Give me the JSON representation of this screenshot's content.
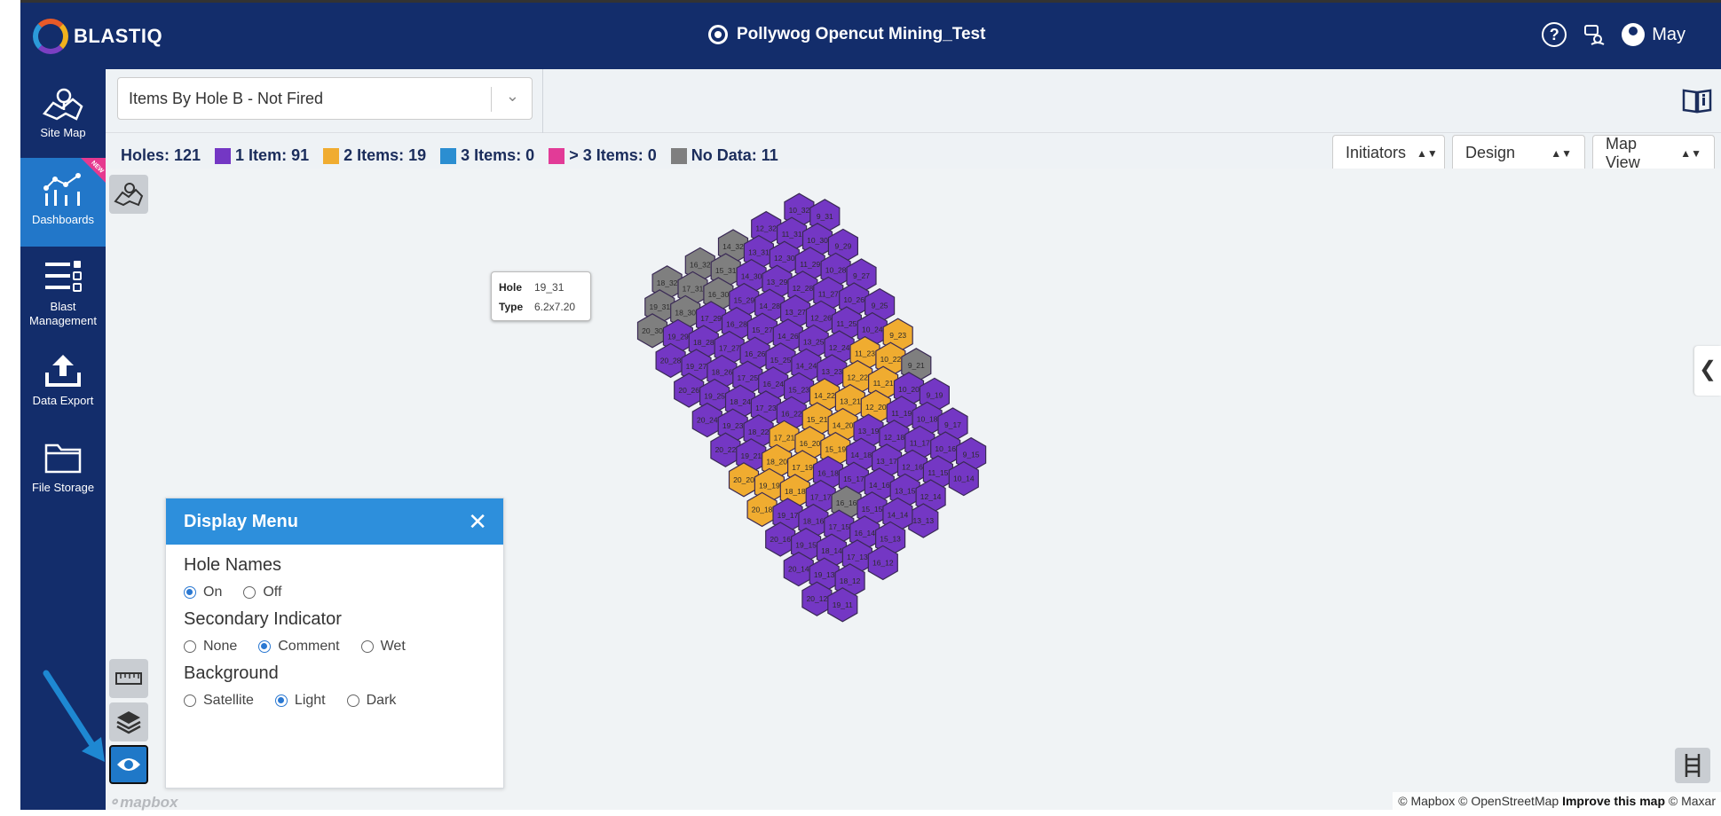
{
  "header": {
    "logo_text": "BLASTIQ",
    "project_title": "Pollywog Opencut Mining_Test",
    "user_name": "May"
  },
  "sidebar": {
    "items": [
      {
        "label": "Site Map",
        "icon": "site-map-icon"
      },
      {
        "label": "Dashboards",
        "icon": "dashboard-icon",
        "active": true,
        "badge": "NEW"
      },
      {
        "label": "Blast Management",
        "icon": "blast-management-icon"
      },
      {
        "label": "Data Export",
        "icon": "upload-icon"
      },
      {
        "label": "File Storage",
        "icon": "folder-icon"
      }
    ]
  },
  "toolbar": {
    "selected_view": "Items By Hole B - Not Fired"
  },
  "legend": {
    "holes": "Holes: 121",
    "items": [
      {
        "label": "1 Item: 91",
        "color": "#7437c4"
      },
      {
        "label": "2 Items: 19",
        "color": "#f0ac30"
      },
      {
        "label": "3 Items: 0",
        "color": "#2b8ed1"
      },
      {
        "label": "> 3 Items: 0",
        "color": "#e23b97"
      },
      {
        "label": "No Data: 11",
        "color": "#7f7f7f"
      }
    ]
  },
  "dropdowns": {
    "initiators": "Initiators",
    "design": "Design",
    "map_view": "Map View"
  },
  "tooltip": {
    "hole_label": "Hole",
    "hole_value": "19_31",
    "type_label": "Type",
    "type_value": "6.2x7.20"
  },
  "display_menu": {
    "title": "Display Menu",
    "hole_names": {
      "label": "Hole Names",
      "options": [
        "On",
        "Off"
      ],
      "selected": "On"
    },
    "secondary": {
      "label": "Secondary Indicator",
      "options": [
        "None",
        "Comment",
        "Wet"
      ],
      "selected": "Comment"
    },
    "background": {
      "label": "Background",
      "options": [
        "Satellite",
        "Light",
        "Dark"
      ],
      "selected": "Light"
    }
  },
  "attribution": {
    "mapbox": "© Mapbox",
    "osm": "© OpenStreetMap",
    "improve": "Improve this map",
    "maxar": "© Maxar"
  },
  "mapbox_logo": "mapbox",
  "pattern": {
    "colors": {
      "purple": "#7437c4",
      "yellow": "#f0ac30",
      "gray": "#7f7f7f"
    },
    "holes_top_right_to_left_rows": [
      [
        [
          "10_32",
          "P"
        ],
        [
          "9_31",
          "P"
        ]
      ],
      [
        [
          "12_32",
          "P"
        ],
        [
          "11_31",
          "P"
        ],
        [
          "10_30",
          "P"
        ],
        [
          "9_29",
          "P"
        ]
      ],
      [
        [
          "14_32",
          "G"
        ],
        [
          "13_31",
          "P"
        ],
        [
          "12_30",
          "P"
        ],
        [
          "11_29",
          "P"
        ],
        [
          "10_28",
          "P"
        ],
        [
          "9_27",
          "P"
        ]
      ],
      [
        [
          "16_32",
          "G"
        ],
        [
          "15_31",
          "G"
        ],
        [
          "14_30",
          "P"
        ],
        [
          "13_29",
          "P"
        ],
        [
          "12_28",
          "P"
        ],
        [
          "11_27",
          "P"
        ],
        [
          "10_26",
          "P"
        ],
        [
          "9_25",
          "P"
        ]
      ],
      [
        [
          "18_32",
          "G"
        ],
        [
          "17_31",
          "G"
        ],
        [
          "16_30",
          "G"
        ],
        [
          "15_29",
          "P"
        ],
        [
          "14_28",
          "P"
        ],
        [
          "13_27",
          "P"
        ],
        [
          "12_26",
          "P"
        ],
        [
          "11_25",
          "P"
        ],
        [
          "10_24",
          "P"
        ],
        [
          "9_23",
          "Y"
        ]
      ],
      [
        [
          "19_31",
          "G"
        ],
        [
          "18_30",
          "G"
        ],
        [
          "17_29",
          "P"
        ],
        [
          "16_28",
          "P"
        ],
        [
          "15_27",
          "P"
        ],
        [
          "14_26",
          "P"
        ],
        [
          "13_25",
          "P"
        ],
        [
          "12_24",
          "P"
        ],
        [
          "11_23",
          "Y"
        ],
        [
          "10_22",
          "Y"
        ],
        [
          "9_21",
          "G"
        ]
      ],
      [
        [
          "20_30",
          "G"
        ],
        [
          "19_29",
          "P"
        ],
        [
          "18_28",
          "P"
        ],
        [
          "17_27",
          "P"
        ],
        [
          "16_26",
          "P"
        ],
        [
          "15_25",
          "P"
        ],
        [
          "14_24",
          "P"
        ],
        [
          "13_23",
          "P"
        ],
        [
          "12_22",
          "Y"
        ],
        [
          "11_21",
          "Y"
        ],
        [
          "10_20",
          "P"
        ],
        [
          "9_19",
          "P"
        ]
      ],
      [
        [
          "20_28",
          "P"
        ],
        [
          "19_27",
          "P"
        ],
        [
          "18_26",
          "P"
        ],
        [
          "17_25",
          "P"
        ],
        [
          "16_24",
          "P"
        ],
        [
          "15_23",
          "P"
        ],
        [
          "14_22",
          "Y"
        ],
        [
          "13_21",
          "Y"
        ],
        [
          "12_20",
          "Y"
        ],
        [
          "11_19",
          "P"
        ],
        [
          "10_18",
          "P"
        ],
        [
          "9_17",
          "P"
        ]
      ],
      [
        [
          "20_26",
          "P"
        ],
        [
          "19_25",
          "P"
        ],
        [
          "18_24",
          "P"
        ],
        [
          "17_23",
          "P"
        ],
        [
          "16_22",
          "P"
        ],
        [
          "15_21",
          "Y"
        ],
        [
          "14_20",
          "Y"
        ],
        [
          "13_19",
          "P"
        ],
        [
          "12_18",
          "P"
        ],
        [
          "11_17",
          "P"
        ],
        [
          "10_16",
          "P"
        ],
        [
          "9_15",
          "P"
        ]
      ],
      [
        [
          "20_24",
          "P"
        ],
        [
          "19_23",
          "P"
        ],
        [
          "18_22",
          "P"
        ],
        [
          "17_21",
          "Y"
        ],
        [
          "16_20",
          "Y"
        ],
        [
          "15_19",
          "Y"
        ],
        [
          "14_18",
          "P"
        ],
        [
          "13_17",
          "P"
        ],
        [
          "12_16",
          "P"
        ],
        [
          "11_15",
          "P"
        ],
        [
          "10_14",
          "P"
        ]
      ],
      [
        [
          "20_22",
          "P"
        ],
        [
          "19_21",
          "P"
        ],
        [
          "18_20",
          "Y"
        ],
        [
          "17_19",
          "Y"
        ],
        [
          "16_18",
          "P"
        ],
        [
          "15_17",
          "P"
        ],
        [
          "14_16",
          "P"
        ],
        [
          "13_15",
          "P"
        ],
        [
          "12_14",
          "P"
        ],
        [
          "13_13",
          "P"
        ]
      ],
      [
        [
          "20_20",
          "Y"
        ],
        [
          "19_19",
          "Y"
        ],
        [
          "18_18",
          "Y"
        ],
        [
          "17_17",
          "P"
        ],
        [
          "16_16",
          "G"
        ],
        [
          "15_15",
          "P"
        ],
        [
          "14_14",
          "P"
        ]
      ],
      [
        [
          "20_18",
          "Y"
        ],
        [
          "19_17",
          "P"
        ],
        [
          "18_16",
          "P"
        ],
        [
          "17_15",
          "P"
        ],
        [
          "16_14",
          "P"
        ],
        [
          "15_13",
          "P"
        ]
      ],
      [
        [
          "20_16",
          "P"
        ],
        [
          "19_15",
          "P"
        ],
        [
          "18_14",
          "P"
        ],
        [
          "17_13",
          "P"
        ],
        [
          "16_12",
          "P"
        ]
      ],
      [
        [
          "20_14",
          "P"
        ],
        [
          "19_13",
          "P"
        ],
        [
          "18_12",
          "P"
        ]
      ],
      [
        [
          "20_12",
          "P"
        ],
        [
          "19_11",
          "P"
        ]
      ]
    ]
  }
}
